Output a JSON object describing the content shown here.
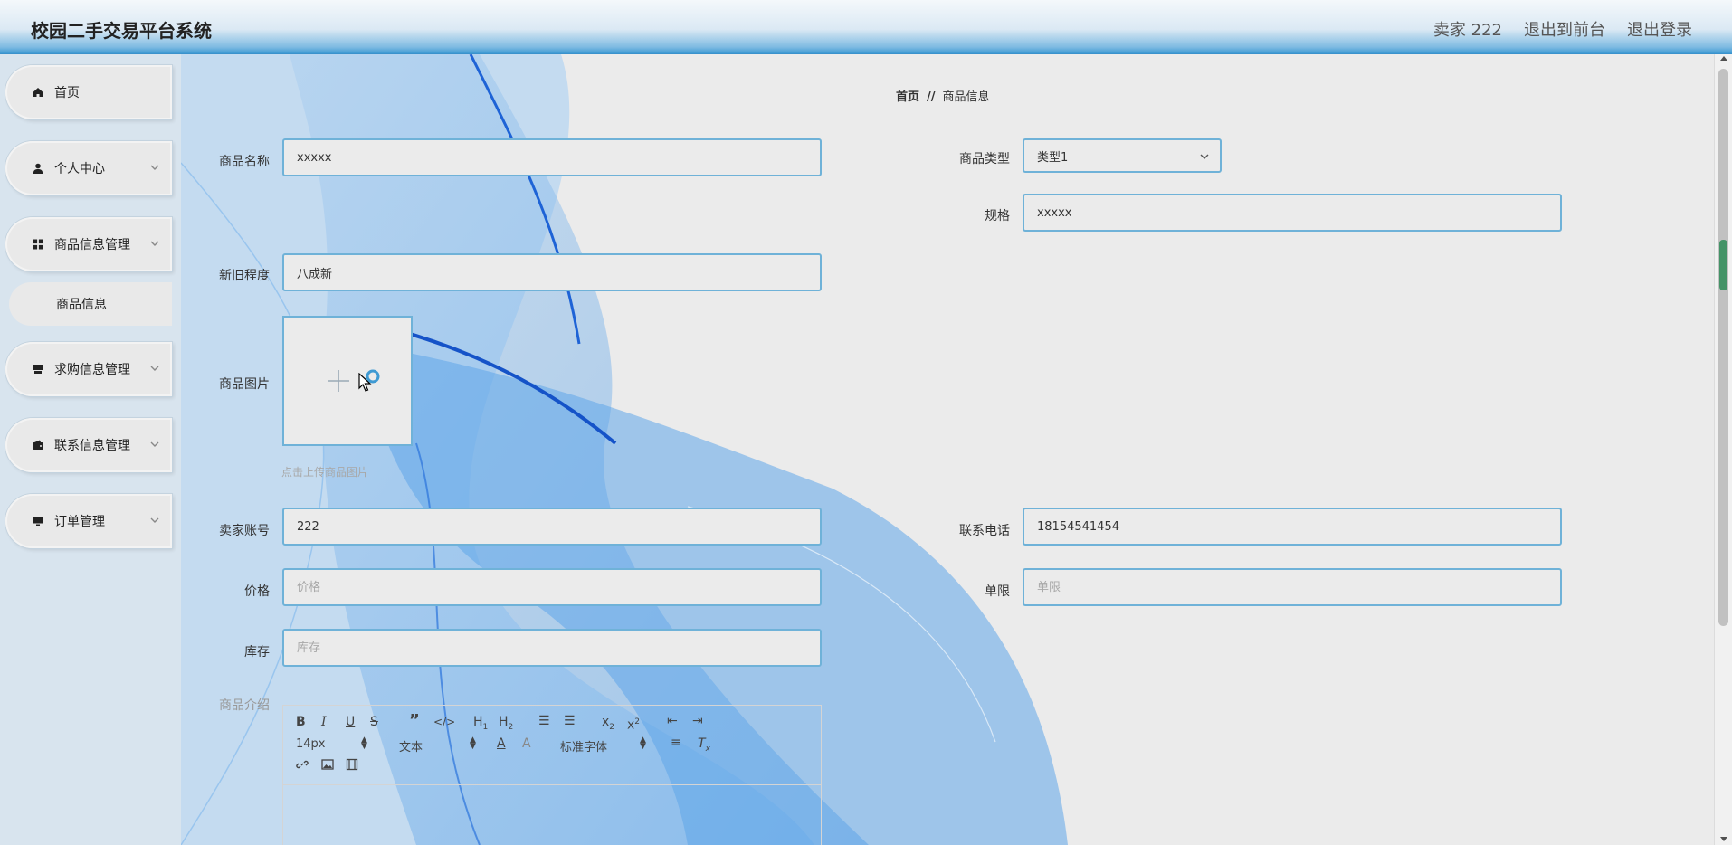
{
  "header": {
    "title": "校园二手交易平台系统",
    "user_label": "卖家 222",
    "to_front_label": "退出到前台",
    "logout_label": "退出登录"
  },
  "sidebar": {
    "items": [
      {
        "label": "首页",
        "icon": "home-icon"
      },
      {
        "label": "个人中心",
        "icon": "user-icon"
      },
      {
        "label": "商品信息管理",
        "icon": "grid-icon"
      },
      {
        "label": "求购信息管理",
        "icon": "shop-icon"
      },
      {
        "label": "联系信息管理",
        "icon": "wallet-icon"
      },
      {
        "label": "订单管理",
        "icon": "monitor-icon"
      }
    ],
    "sub_item_label": "商品信息"
  },
  "breadcrumb": {
    "home": "首页",
    "separator": "//",
    "current": "商品信息"
  },
  "form": {
    "name": {
      "label": "商品名称",
      "value": "xxxxx"
    },
    "type": {
      "label": "商品类型",
      "value": "类型1"
    },
    "spec": {
      "label": "规格",
      "value": "xxxxx"
    },
    "condition": {
      "label": "新旧程度",
      "value": "八成新"
    },
    "image": {
      "label": "商品图片",
      "tip": "点击上传商品图片"
    },
    "seller_account": {
      "label": "卖家账号",
      "value": "222"
    },
    "phone": {
      "label": "联系电话",
      "value": "18154541454"
    },
    "price": {
      "label": "价格",
      "placeholder": "价格"
    },
    "limit": {
      "label": "单限",
      "placeholder": "单限"
    },
    "stock": {
      "label": "库存",
      "placeholder": "库存"
    },
    "intro": {
      "label": "商品介绍"
    }
  },
  "editor": {
    "font_size": "14px",
    "header_select": "文本",
    "font_family": "标准字体"
  },
  "colors": {
    "accent": "#3f9ad3",
    "input_border": "#6fb2d8",
    "main_bg": "#ebebeb",
    "sidebar_bg": "#d8e4ee"
  }
}
